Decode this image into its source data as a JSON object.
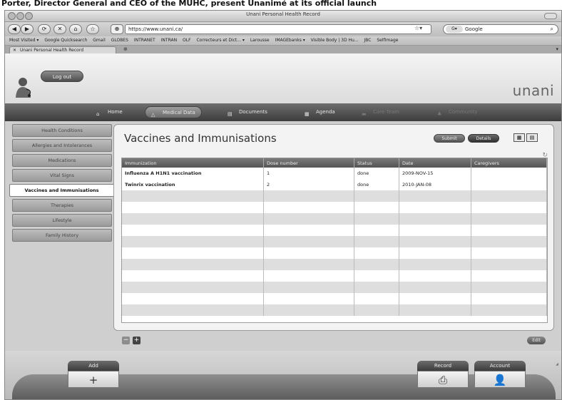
{
  "caption": "Porter, Director General and CEO of the MUHC, present Unanimé at its official launch",
  "window": {
    "title": "Unani Personal Health Record"
  },
  "browser": {
    "back_label": "◀",
    "forward_label": "▶",
    "url": "https://www.unani.ca/",
    "search_engine": "Google",
    "bookmarks": [
      "Most Visited ▾",
      "Google Quicksearch",
      "Gmail",
      "GLOBES",
      "INTRANET",
      "INTRAN",
      "OLF",
      "Correcteurs et Dict... ▾",
      "Larousse",
      "IMAGEbanks ▾",
      "Visible Body | 3D Hu...",
      "JBC",
      "SelfImage"
    ],
    "tab_label": "Unani Personal Health Record"
  },
  "app": {
    "logout_label": "Log out",
    "brand": "unani",
    "nav": [
      {
        "label": "Home"
      },
      {
        "label": "Medical Data"
      },
      {
        "label": "Documents"
      },
      {
        "label": "Agenda"
      },
      {
        "label": "Care Team"
      },
      {
        "label": "Community"
      }
    ],
    "sidebar": [
      {
        "label": "Health Conditions"
      },
      {
        "label": "Allergies and Intolerances"
      },
      {
        "label": "Medications"
      },
      {
        "label": "Vital Signs"
      },
      {
        "label": "Vaccines and Immunisations"
      },
      {
        "label": "Therapies"
      },
      {
        "label": "Lifestyle"
      },
      {
        "label": "Family History"
      }
    ],
    "panel": {
      "title": "Vaccines and Immunisations",
      "submit_label": "Submit",
      "details_label": "Details",
      "edit_label": "Edit"
    },
    "table": {
      "columns": [
        "Immunization",
        "Dose number",
        "Status",
        "Date",
        "Caregivers"
      ],
      "rows": [
        [
          "Influenza A H1N1 vaccination",
          "1",
          "done",
          "2009-NOV-15",
          ""
        ],
        [
          "Twinrix vaccination",
          "2",
          "done",
          "2010-JAN-08",
          ""
        ]
      ]
    },
    "bottom": {
      "add_label": "Add",
      "record_label": "Record",
      "account_label": "Account"
    }
  },
  "icons": {
    "home": "house-icon",
    "plus": "plus-icon",
    "print": "printer-icon",
    "person": "person-icon"
  },
  "colors": {
    "nav_bg": "#4a4a4a",
    "panel_bg": "#f3f3f3",
    "header_row": "#5f5f5f"
  }
}
